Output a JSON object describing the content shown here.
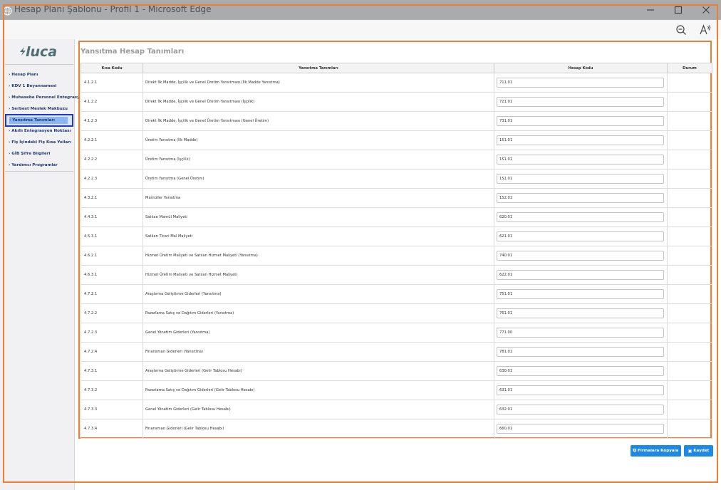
{
  "window": {
    "title": "Hesap Planı Şablonu - Profil 1 - Microsoft Edge"
  },
  "toolbar": {
    "zoom_out_icon": "zoom-out-icon",
    "read_aloud_icon": "read-aloud-icon"
  },
  "sidebar": {
    "logo": "luca",
    "items": [
      {
        "label": "Hesap Planı"
      },
      {
        "label": "KDV 1 Beyannamesi"
      },
      {
        "label": "Muhasebe Personel Entegrasyon"
      },
      {
        "label": "Serbest Meslek Makbuzu"
      },
      {
        "label": "Yansıtma Tanımları"
      },
      {
        "label": "Akıllı Entegrasyon Noktası"
      },
      {
        "label": "Fiş İçindeki Fiş Kısa Yolları"
      },
      {
        "label": "GİB Şifre Bilgileri"
      },
      {
        "label": "Yardımcı Programlar"
      }
    ]
  },
  "main": {
    "title": "Yansıtma Hesap Tanımları",
    "columns": [
      "Kısa Kodu",
      "Yansıtma Tanımları",
      "Hesap Kodu",
      "Durum"
    ],
    "rows": [
      {
        "code": "4.1.2.1",
        "desc": "Direkt İlk Madde, İşçilik ve Genel Üretim Yansıtması (İlk Madde Yansıtma)",
        "account": "711.01"
      },
      {
        "code": "4.1.2.2",
        "desc": "Direkt İlk Madde, İşçilik ve Genel Üretim Yansıtması (İşçilik)",
        "account": "721.01"
      },
      {
        "code": "4.1.2.3",
        "desc": "Direkt İlk Madde, İşçilik ve Genel Üretim Yansıtması (Genel Üretim)",
        "account": "731.01"
      },
      {
        "code": "4.2.2.1",
        "desc": "Üretim Yansıtma (İlk Madde)",
        "account": "151.01"
      },
      {
        "code": "4.2.2.2",
        "desc": "Üretim Yansıtma (İşçilik)",
        "account": "151.01"
      },
      {
        "code": "4.2.2.3",
        "desc": "Üretim Yansıtma (Genel Üretim)",
        "account": "151.01"
      },
      {
        "code": "4.3.2.1",
        "desc": "Mamüller Yansıtma",
        "account": "152.01"
      },
      {
        "code": "4.4.3.1",
        "desc": "Satılan Mamül Maliyeti",
        "account": "620.01"
      },
      {
        "code": "4.5.3.1",
        "desc": "Satılan Ticari Mal Maliyeti",
        "account": "621.01"
      },
      {
        "code": "4.6.2.1",
        "desc": "Hizmet Üretim Maliyeti ve Satılan Hizmet Maliyeti (Yansıtma)",
        "account": "740.01"
      },
      {
        "code": "4.6.3.1",
        "desc": "Hizmet Üretim Maliyeti ve Satılan Hizmet Maliyeti",
        "account": "622.01"
      },
      {
        "code": "4.7.2.1",
        "desc": "Araştırma Geliştirme Giderleri (Yansıtma)",
        "account": "751.01"
      },
      {
        "code": "4.7.2.2",
        "desc": "Pazarlama Satış ve Dağıtım Giderleri (Yansıtma)",
        "account": "761.01"
      },
      {
        "code": "4.7.2.3",
        "desc": "Genel Yönetim Giderleri (Yansıtma)",
        "account": "771.00"
      },
      {
        "code": "4.7.2.4",
        "desc": "Finansman Giderleri (Yansıtma)",
        "account": "781.01"
      },
      {
        "code": "4.7.3.1",
        "desc": "Araştırma Geliştirme Giderleri (Gelir Tablosu Hesabı)",
        "account": "630.01"
      },
      {
        "code": "4.7.3.2",
        "desc": "Pazarlama Satış ve Dağıtım Giderleri (Gelir Tablosu Hesabı)",
        "account": "631.01"
      },
      {
        "code": "4.7.3.3",
        "desc": "Genel Yönetim Giderleri (Gelir Tablosu Hesabı)",
        "account": "632.01"
      },
      {
        "code": "4.7.3.4",
        "desc": "Finansman Giderleri (Gelir Tablosu Hesabı)",
        "account": "660.01"
      }
    ]
  },
  "actions": {
    "copy_label": "Firmalara Kopyala",
    "save_label": "Kaydet"
  },
  "colors": {
    "highlight_frame": "#ef7d33",
    "button": "#1e88e5",
    "active_nav_outline": "#1d39c9"
  }
}
